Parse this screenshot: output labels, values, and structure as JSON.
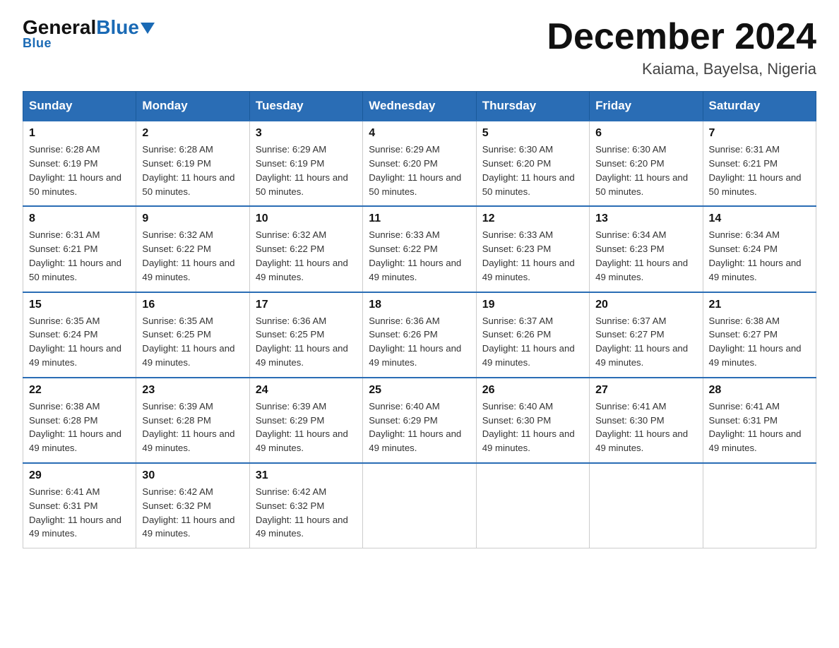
{
  "header": {
    "logo_general": "General",
    "logo_blue": "Blue",
    "month_title": "December 2024",
    "location": "Kaiama, Bayelsa, Nigeria"
  },
  "days_of_week": [
    "Sunday",
    "Monday",
    "Tuesday",
    "Wednesday",
    "Thursday",
    "Friday",
    "Saturday"
  ],
  "weeks": [
    [
      {
        "day": "1",
        "sunrise": "6:28 AM",
        "sunset": "6:19 PM",
        "daylight": "11 hours and 50 minutes."
      },
      {
        "day": "2",
        "sunrise": "6:28 AM",
        "sunset": "6:19 PM",
        "daylight": "11 hours and 50 minutes."
      },
      {
        "day": "3",
        "sunrise": "6:29 AM",
        "sunset": "6:19 PM",
        "daylight": "11 hours and 50 minutes."
      },
      {
        "day": "4",
        "sunrise": "6:29 AM",
        "sunset": "6:20 PM",
        "daylight": "11 hours and 50 minutes."
      },
      {
        "day": "5",
        "sunrise": "6:30 AM",
        "sunset": "6:20 PM",
        "daylight": "11 hours and 50 minutes."
      },
      {
        "day": "6",
        "sunrise": "6:30 AM",
        "sunset": "6:20 PM",
        "daylight": "11 hours and 50 minutes."
      },
      {
        "day": "7",
        "sunrise": "6:31 AM",
        "sunset": "6:21 PM",
        "daylight": "11 hours and 50 minutes."
      }
    ],
    [
      {
        "day": "8",
        "sunrise": "6:31 AM",
        "sunset": "6:21 PM",
        "daylight": "11 hours and 50 minutes."
      },
      {
        "day": "9",
        "sunrise": "6:32 AM",
        "sunset": "6:22 PM",
        "daylight": "11 hours and 49 minutes."
      },
      {
        "day": "10",
        "sunrise": "6:32 AM",
        "sunset": "6:22 PM",
        "daylight": "11 hours and 49 minutes."
      },
      {
        "day": "11",
        "sunrise": "6:33 AM",
        "sunset": "6:22 PM",
        "daylight": "11 hours and 49 minutes."
      },
      {
        "day": "12",
        "sunrise": "6:33 AM",
        "sunset": "6:23 PM",
        "daylight": "11 hours and 49 minutes."
      },
      {
        "day": "13",
        "sunrise": "6:34 AM",
        "sunset": "6:23 PM",
        "daylight": "11 hours and 49 minutes."
      },
      {
        "day": "14",
        "sunrise": "6:34 AM",
        "sunset": "6:24 PM",
        "daylight": "11 hours and 49 minutes."
      }
    ],
    [
      {
        "day": "15",
        "sunrise": "6:35 AM",
        "sunset": "6:24 PM",
        "daylight": "11 hours and 49 minutes."
      },
      {
        "day": "16",
        "sunrise": "6:35 AM",
        "sunset": "6:25 PM",
        "daylight": "11 hours and 49 minutes."
      },
      {
        "day": "17",
        "sunrise": "6:36 AM",
        "sunset": "6:25 PM",
        "daylight": "11 hours and 49 minutes."
      },
      {
        "day": "18",
        "sunrise": "6:36 AM",
        "sunset": "6:26 PM",
        "daylight": "11 hours and 49 minutes."
      },
      {
        "day": "19",
        "sunrise": "6:37 AM",
        "sunset": "6:26 PM",
        "daylight": "11 hours and 49 minutes."
      },
      {
        "day": "20",
        "sunrise": "6:37 AM",
        "sunset": "6:27 PM",
        "daylight": "11 hours and 49 minutes."
      },
      {
        "day": "21",
        "sunrise": "6:38 AM",
        "sunset": "6:27 PM",
        "daylight": "11 hours and 49 minutes."
      }
    ],
    [
      {
        "day": "22",
        "sunrise": "6:38 AM",
        "sunset": "6:28 PM",
        "daylight": "11 hours and 49 minutes."
      },
      {
        "day": "23",
        "sunrise": "6:39 AM",
        "sunset": "6:28 PM",
        "daylight": "11 hours and 49 minutes."
      },
      {
        "day": "24",
        "sunrise": "6:39 AM",
        "sunset": "6:29 PM",
        "daylight": "11 hours and 49 minutes."
      },
      {
        "day": "25",
        "sunrise": "6:40 AM",
        "sunset": "6:29 PM",
        "daylight": "11 hours and 49 minutes."
      },
      {
        "day": "26",
        "sunrise": "6:40 AM",
        "sunset": "6:30 PM",
        "daylight": "11 hours and 49 minutes."
      },
      {
        "day": "27",
        "sunrise": "6:41 AM",
        "sunset": "6:30 PM",
        "daylight": "11 hours and 49 minutes."
      },
      {
        "day": "28",
        "sunrise": "6:41 AM",
        "sunset": "6:31 PM",
        "daylight": "11 hours and 49 minutes."
      }
    ],
    [
      {
        "day": "29",
        "sunrise": "6:41 AM",
        "sunset": "6:31 PM",
        "daylight": "11 hours and 49 minutes."
      },
      {
        "day": "30",
        "sunrise": "6:42 AM",
        "sunset": "6:32 PM",
        "daylight": "11 hours and 49 minutes."
      },
      {
        "day": "31",
        "sunrise": "6:42 AM",
        "sunset": "6:32 PM",
        "daylight": "11 hours and 49 minutes."
      },
      null,
      null,
      null,
      null
    ]
  ],
  "labels": {
    "sunrise_prefix": "Sunrise: ",
    "sunset_prefix": "Sunset: ",
    "daylight_prefix": "Daylight: "
  }
}
